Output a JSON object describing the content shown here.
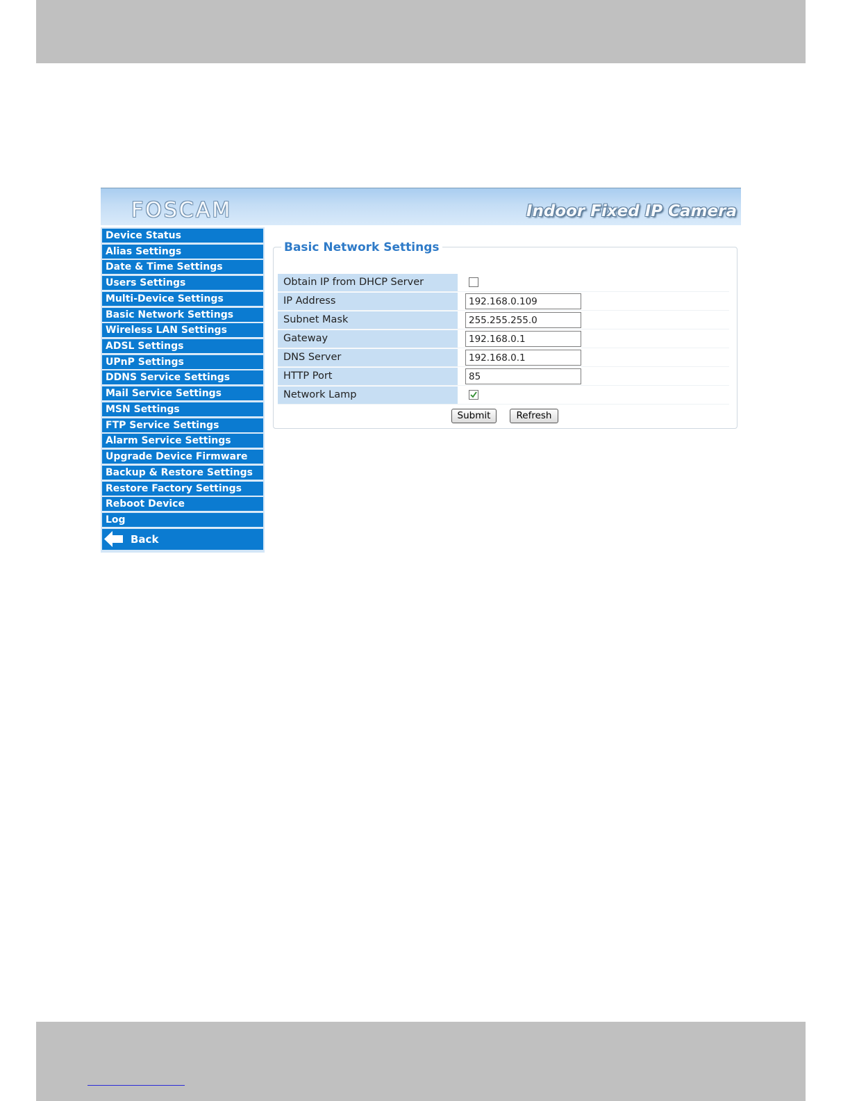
{
  "header": {
    "logo_text": "FOSCAM",
    "title": "Indoor Fixed IP Camera"
  },
  "sidebar": {
    "items": [
      {
        "label": "Device Status"
      },
      {
        "label": "Alias Settings"
      },
      {
        "label": "Date & Time Settings"
      },
      {
        "label": "Users Settings"
      },
      {
        "label": "Multi-Device Settings"
      },
      {
        "label": "Basic Network Settings"
      },
      {
        "label": "Wireless LAN Settings"
      },
      {
        "label": "ADSL Settings"
      },
      {
        "label": "UPnP Settings"
      },
      {
        "label": "DDNS Service Settings"
      },
      {
        "label": "Mail Service Settings"
      },
      {
        "label": "MSN Settings"
      },
      {
        "label": "FTP Service Settings"
      },
      {
        "label": "Alarm Service Settings"
      },
      {
        "label": "Upgrade Device Firmware"
      },
      {
        "label": "Backup & Restore Settings"
      },
      {
        "label": "Restore Factory Settings"
      },
      {
        "label": "Reboot Device"
      },
      {
        "label": "Log"
      }
    ],
    "back_label": "Back"
  },
  "form": {
    "title": "Basic Network Settings",
    "dhcp": {
      "label": "Obtain IP from DHCP Server",
      "checked": false
    },
    "ip": {
      "label": "IP Address",
      "value": "192.168.0.109"
    },
    "subnet": {
      "label": "Subnet Mask",
      "value": "255.255.255.0"
    },
    "gateway": {
      "label": "Gateway",
      "value": "192.168.0.1"
    },
    "dns": {
      "label": "DNS Server",
      "value": "192.168.0.1"
    },
    "port": {
      "label": "HTTP Port",
      "value": "85"
    },
    "lamp": {
      "label": "Network Lamp",
      "checked": true
    },
    "submit_label": "Submit",
    "refresh_label": "Refresh"
  },
  "colors": {
    "nav_bg": "#0b7bd1",
    "label_bg": "#c7def3",
    "title_blue": "#2f7bc8",
    "check_green": "#2e8b2e"
  }
}
